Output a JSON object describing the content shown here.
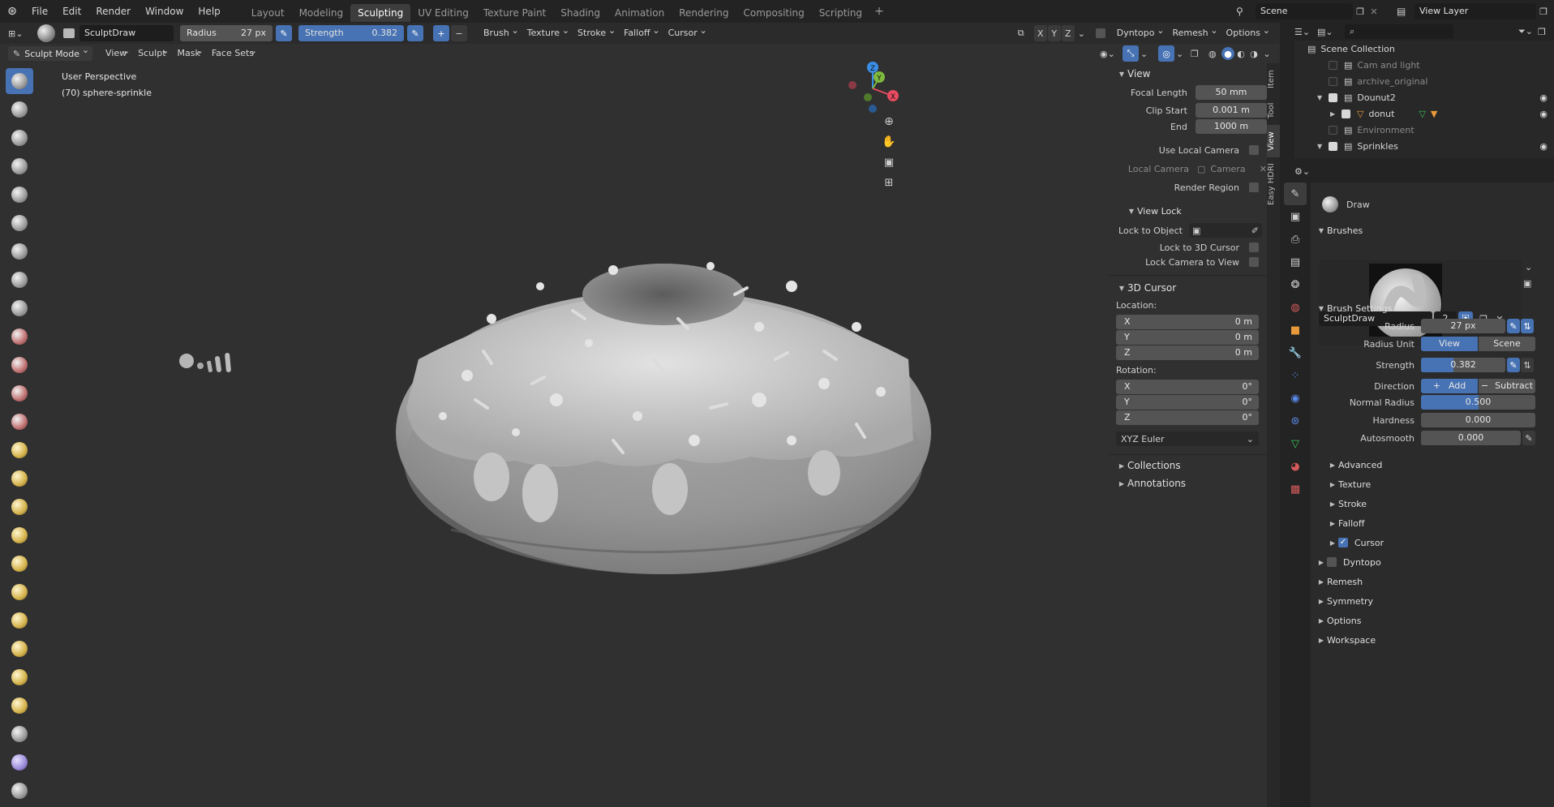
{
  "menu": [
    "File",
    "Edit",
    "Render",
    "Window",
    "Help"
  ],
  "workspaces": [
    "Layout",
    "Modeling",
    "Sculpting",
    "UV Editing",
    "Texture Paint",
    "Shading",
    "Animation",
    "Rendering",
    "Compositing",
    "Scripting"
  ],
  "active_workspace": "Sculpting",
  "scene_name": "Scene",
  "view_layer": "View Layer",
  "header": {
    "brush_name": "SculptDraw",
    "radius_label": "Radius",
    "radius_value": "27 px",
    "strength_label": "Strength",
    "strength_value": "0.382",
    "menus": [
      "Brush",
      "Texture",
      "Stroke",
      "Falloff",
      "Cursor"
    ],
    "axes": [
      "X",
      "Y",
      "Z"
    ],
    "dyntopo": "Dyntopo",
    "remesh": "Remesh",
    "options": "Options"
  },
  "mode_bar": {
    "mode": "Sculpt Mode",
    "items": [
      "View",
      "Sculpt",
      "Mask",
      "Face Sets"
    ]
  },
  "viewport": {
    "perspective": "User Perspective",
    "object": "(70) sphere-sprinkle",
    "gizmo_axes": [
      "X",
      "Y",
      "Z"
    ]
  },
  "npanel": {
    "view_title": "View",
    "focal_length_label": "Focal Length",
    "focal_length": "50 mm",
    "clip_start_label": "Clip Start",
    "clip_start": "0.001 m",
    "end_label": "End",
    "end": "1000 m",
    "use_local_camera": "Use Local Camera",
    "local_camera_label": "Local Camera",
    "local_camera": "Camera",
    "render_region": "Render Region",
    "view_lock_title": "View Lock",
    "lock_to_object": "Lock to Object",
    "lock_to_3d_cursor": "Lock to 3D Cursor",
    "lock_camera_to_view": "Lock Camera to View",
    "cursor_title": "3D Cursor",
    "location_label": "Location:",
    "location": [
      {
        "axis": "X",
        "value": "0 m"
      },
      {
        "axis": "Y",
        "value": "0 m"
      },
      {
        "axis": "Z",
        "value": "0 m"
      }
    ],
    "rotation_label": "Rotation:",
    "rotation": [
      {
        "axis": "X",
        "value": "0°"
      },
      {
        "axis": "Y",
        "value": "0°"
      },
      {
        "axis": "Z",
        "value": "0°"
      }
    ],
    "rotation_mode": "XYZ Euler",
    "collections": "Collections",
    "annotations": "Annotations"
  },
  "side_tabs": [
    "Item",
    "Tool",
    "View",
    "Easy HDRI"
  ],
  "outliner": {
    "title": "Scene Collection",
    "rows": [
      {
        "name": "Cam and light",
        "indent": 1,
        "dim": true
      },
      {
        "name": "archive_original",
        "indent": 1,
        "dim": true
      },
      {
        "name": "Dounut2",
        "indent": 1,
        "dim": false
      },
      {
        "name": "donut",
        "indent": 2,
        "dim": false
      },
      {
        "name": "Environment",
        "indent": 1,
        "dim": true
      },
      {
        "name": "Sprinkles",
        "indent": 1,
        "dim": false
      }
    ]
  },
  "properties": {
    "tool_name": "Draw",
    "brushes_title": "Brushes",
    "brush_name": "SculptDraw",
    "brush_users": "2",
    "brush_settings_title": "Brush Settings",
    "radius_label": "Radius",
    "radius": "27 px",
    "radius_unit_label": "Radius Unit",
    "radius_unit_view": "View",
    "radius_unit_scene": "Scene",
    "strength_label": "Strength",
    "strength": "0.382",
    "strength_fraction": 0.382,
    "direction_label": "Direction",
    "direction_add": "Add",
    "direction_subtract": "Subtract",
    "normal_radius_label": "Normal Radius",
    "normal_radius": "0.500",
    "normal_radius_fraction": 0.5,
    "hardness_label": "Hardness",
    "hardness": "0.000",
    "autosmooth_label": "Autosmooth",
    "autosmooth": "0.000",
    "sub_sections": [
      "Advanced",
      "Texture",
      "Stroke",
      "Falloff",
      "Cursor"
    ],
    "sections": [
      "Dyntopo",
      "Remesh",
      "Symmetry",
      "Options",
      "Workspace"
    ]
  },
  "colors": {
    "accent": "#4772b3",
    "axis_x": "#e84a5f",
    "axis_y": "#7fba3f",
    "axis_z": "#3a8ee6"
  }
}
